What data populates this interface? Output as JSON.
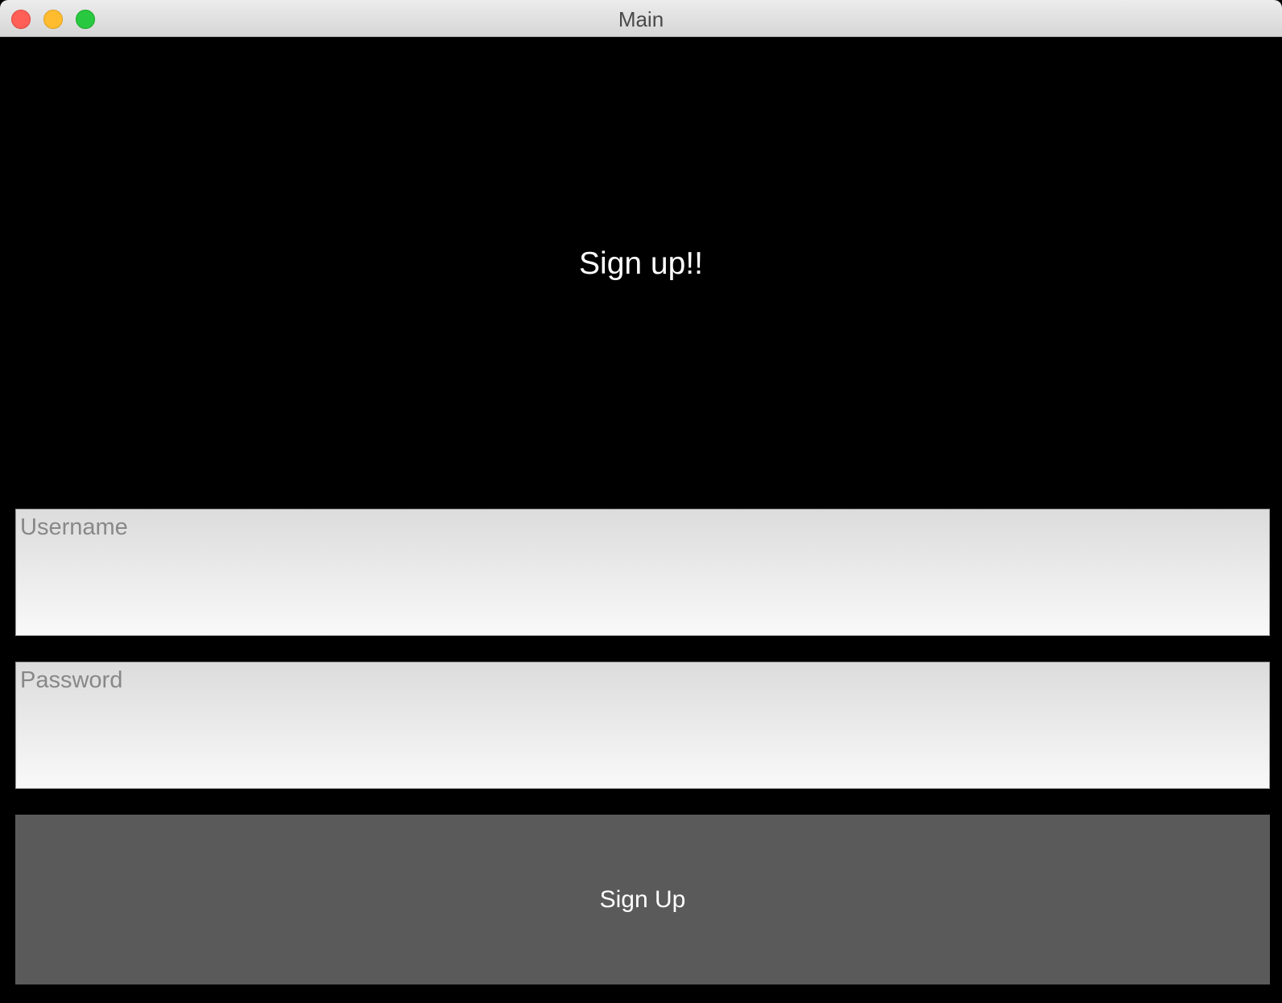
{
  "window": {
    "title": "Main"
  },
  "main": {
    "heading": "Sign up!!",
    "username_field": {
      "placeholder": "Username",
      "value": ""
    },
    "password_field": {
      "placeholder": "Password",
      "value": ""
    },
    "signup_button_label": "Sign Up"
  },
  "colors": {
    "background": "#000000",
    "button": "#5a5a5a",
    "heading_text": "#ffffff",
    "placeholder_text": "#888888"
  }
}
